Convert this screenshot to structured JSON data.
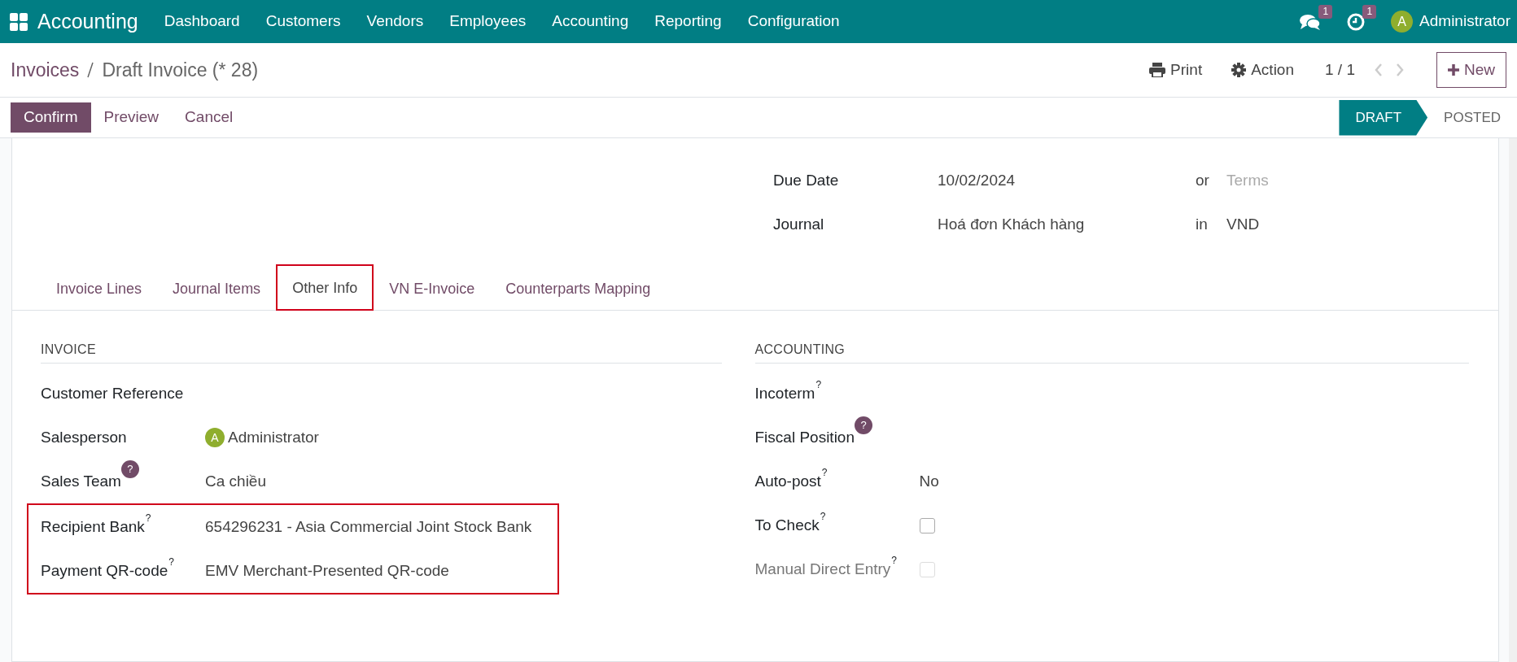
{
  "navbar": {
    "app_name": "Accounting",
    "menu": [
      "Dashboard",
      "Customers",
      "Vendors",
      "Employees",
      "Accounting",
      "Reporting",
      "Configuration"
    ],
    "messages_badge": "1",
    "activities_badge": "1",
    "user": {
      "initial": "A",
      "name": "Administrator"
    }
  },
  "breadcrumb": [
    {
      "label": "Invoices"
    },
    {
      "label": "Draft Invoice (* 28)"
    }
  ],
  "control_panel": {
    "print": "Print",
    "action": "Action",
    "pager": "1 / 1",
    "new": "New"
  },
  "buttons": [
    {
      "label": "Confirm",
      "primary": true
    },
    {
      "label": "Preview",
      "primary": false
    },
    {
      "label": "Cancel",
      "primary": false
    }
  ],
  "status_steps": [
    {
      "label": "DRAFT",
      "selected": true
    },
    {
      "label": "POSTED",
      "selected": false
    }
  ],
  "header_fields": [
    {
      "label": "Due Date",
      "value": "10/02/2024",
      "connector": "or",
      "placeholder": "Terms"
    },
    {
      "label": "Journal",
      "value": "Hoá đơn Khách hàng",
      "connector": "in",
      "extra": "VND"
    }
  ],
  "tabs": [
    {
      "label": "Invoice Lines",
      "selected": false,
      "highlighted": false
    },
    {
      "label": "Journal Items",
      "selected": false,
      "highlighted": false
    },
    {
      "label": "Other Info",
      "selected": true,
      "highlighted": true
    },
    {
      "label": "VN E-Invoice",
      "selected": false,
      "highlighted": false
    },
    {
      "label": "Counterparts Mapping",
      "selected": false,
      "highlighted": false
    }
  ],
  "sections": [
    {
      "title": "INVOICE",
      "fields": [
        {
          "label": "Customer Reference",
          "kind": "empty",
          "highlighted": false
        },
        {
          "label": "Salesperson",
          "kind": "avatar",
          "avatar_initial": "A",
          "value": "Administrator",
          "highlighted": false
        },
        {
          "label": "Sales Team",
          "tooltip": {
            "kind": "badge",
            "text": "?"
          },
          "kind": "text",
          "value": "Ca chiều",
          "highlighted": false
        },
        {
          "label": "Recipient Bank",
          "tooltip": {
            "kind": "superscript",
            "text": "?"
          },
          "kind": "text",
          "value": "654296231 - Asia Commercial Joint Stock Bank",
          "highlighted": true
        },
        {
          "label": "Payment QR-code",
          "tooltip": {
            "kind": "superscript",
            "text": "?"
          },
          "kind": "text",
          "value": "EMV Merchant-Presented QR-code",
          "highlighted": true
        }
      ]
    },
    {
      "title": "ACCOUNTING",
      "fields": [
        {
          "label": "Incoterm",
          "tooltip": {
            "kind": "superscript",
            "text": "?"
          },
          "kind": "empty",
          "highlighted": false
        },
        {
          "label": "Fiscal Position",
          "tooltip": {
            "kind": "badge",
            "text": "?"
          },
          "kind": "empty",
          "highlighted": false
        },
        {
          "label": "Auto-post",
          "tooltip": {
            "kind": "superscript",
            "text": "?"
          },
          "kind": "text",
          "value": "No",
          "highlighted": false
        },
        {
          "label": "To Check",
          "tooltip": {
            "kind": "superscript",
            "text": "?"
          },
          "kind": "checkbox",
          "checked": false,
          "disabled": false,
          "highlighted": false
        },
        {
          "label": "Manual Direct Entry",
          "tooltip": {
            "kind": "superscript",
            "text": "?"
          },
          "kind": "checkbox",
          "checked": false,
          "disabled": true,
          "highlighted": false
        }
      ]
    }
  ]
}
